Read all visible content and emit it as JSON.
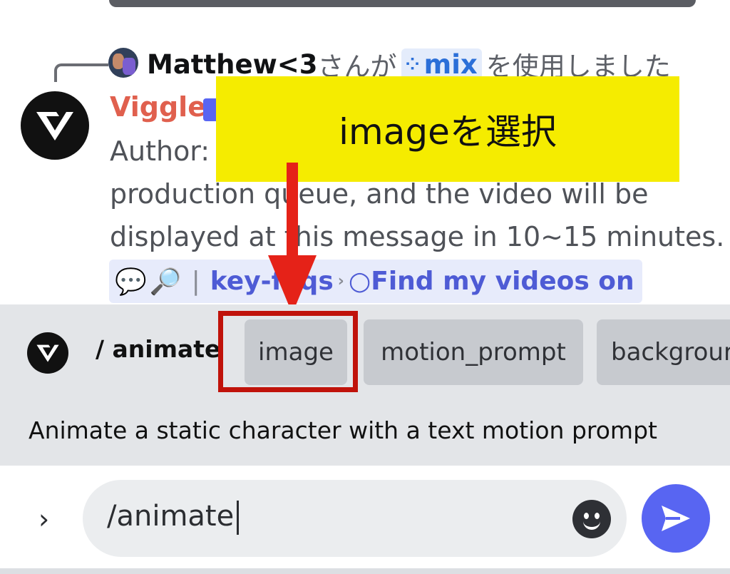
{
  "reply": {
    "username": "Matthew<3",
    "prefix_text": "さんが",
    "command_chip": "mix",
    "suffix_text": "を使用しました"
  },
  "message": {
    "bot_name": "Viggle",
    "line1": "Author: ",
    "line2": "production queue, and the video will be",
    "line3": "displayed at this message in 10~15 minutes.",
    "link_key_faqs": "key-faqs",
    "link_find_videos": "Find my videos on"
  },
  "annotation": {
    "callout_text": "imageを選択"
  },
  "command_panel": {
    "command_name": "/ animate",
    "options": [
      "image",
      "motion_prompt",
      "backgrour"
    ],
    "description": "Animate a static character with a text motion prompt"
  },
  "composer": {
    "input_value": "/animate"
  },
  "colors": {
    "accent": "#5865f2",
    "bot_name": "#e0604e",
    "callout_bg": "#f5ec00",
    "arrow": "#e52218",
    "highlight": "#c0120a"
  }
}
